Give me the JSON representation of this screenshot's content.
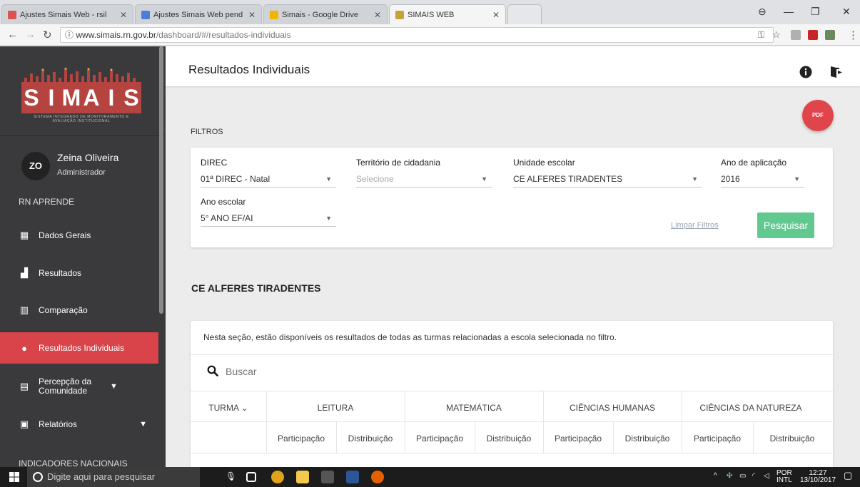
{
  "browser": {
    "tabs": [
      {
        "title": "Ajustes Simais Web - rsil",
        "fav_color": "#d9534f"
      },
      {
        "title": "Ajustes Simais Web pend",
        "fav_color": "#4a7fd4"
      },
      {
        "title": "Simais - Google Drive",
        "fav_color": "#f0b400"
      },
      {
        "title": "SIMAIS WEB",
        "fav_color": "#c9a13b"
      }
    ],
    "url_domain": "www.simais.rn.gov.br",
    "url_path": "/dashboard/#/resultados-individuais"
  },
  "sidebar": {
    "logo_letters": [
      "S",
      "I",
      "M",
      "A",
      "I",
      "S"
    ],
    "logo_tagline": "SISTEMA INTEGRADO DE MONITORAMENTO E AVALIAÇÃO INSTITUCIONAL",
    "user": {
      "initials": "ZO",
      "name": "Zeina Oliveira",
      "role": "Administrador"
    },
    "section_label": "RN APRENDE",
    "items": [
      {
        "label": "Dados Gerais",
        "icon": "▦"
      },
      {
        "label": "Resultados",
        "icon": "📶"
      },
      {
        "label": "Comparação",
        "icon": "ıllı"
      },
      {
        "label": "Resultados Individuais",
        "icon": "●"
      },
      {
        "label": "Percepção da Comunidade",
        "icon": "▤"
      },
      {
        "label": "Relatórios",
        "icon": "▣"
      }
    ],
    "section2_label": "INDICADORES NACIONAIS"
  },
  "header": {
    "title": "Resultados Individuais"
  },
  "pdf_label": "PDF",
  "filters": {
    "section_label": "FILTROS",
    "direc": {
      "label": "DIREC",
      "value": "01ª DIREC - Natal"
    },
    "territorio": {
      "label": "Território de cidadania",
      "placeholder": "Selecione"
    },
    "unidade": {
      "label": "Unidade escolar",
      "value": "CE ALFERES TIRADENTES"
    },
    "ano_aplicacao": {
      "label": "Ano de aplicação",
      "value": "2016"
    },
    "ano_escolar": {
      "label": "Ano escolar",
      "value": "5° ANO EF/AI"
    },
    "clear_label": "Limpar Filtros",
    "search_label": "Pesquisar"
  },
  "school": {
    "name": "CE ALFERES TIRADENTES"
  },
  "results": {
    "intro": "Nesta seção, estão disponíveis os resultados de todas as turmas relacionadas a escola selecionada no filtro.",
    "search_placeholder": "Buscar",
    "col_turma": "TURMA",
    "groups": [
      "LEITURA",
      "MATEMÁTICA",
      "CIÊNCIAS HUMANAS",
      "CIÊNCIAS DA NATUREZA"
    ],
    "sub_participacao": "Participação",
    "sub_distribuicao": "Distribuição"
  },
  "taskbar": {
    "search_placeholder": "Digite aqui para pesquisar",
    "lang_top": "POR",
    "lang_bottom": "INTL",
    "time": "12:27",
    "date": "13/10/2017"
  }
}
